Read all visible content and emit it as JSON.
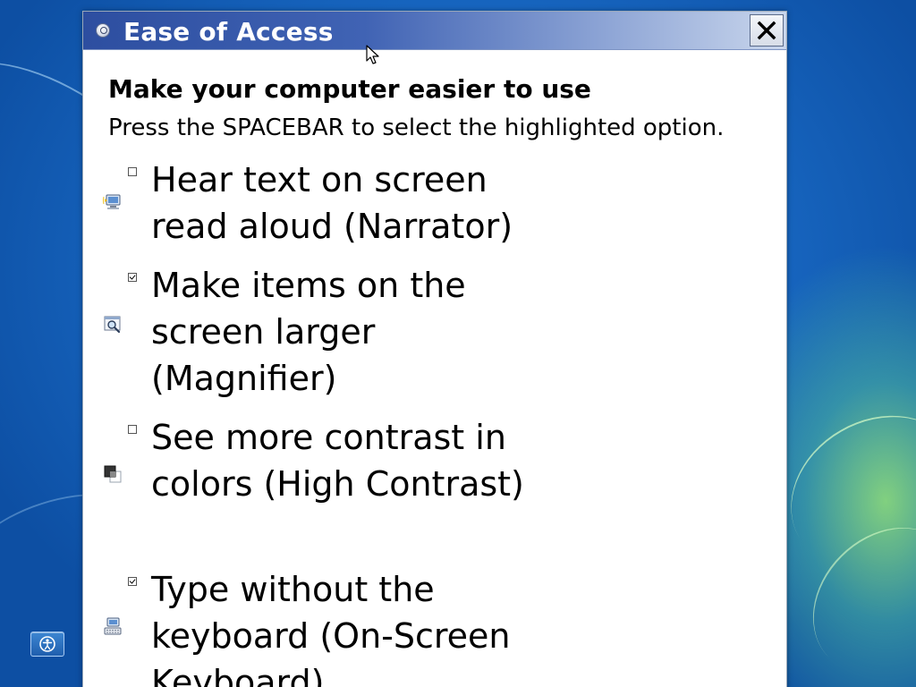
{
  "dialog": {
    "title": "Ease of Access",
    "close_icon": "close-icon",
    "heading": "Make your computer easier to use",
    "instruction": "Press the SPACEBAR to select the highlighted option.",
    "options": [
      {
        "label": "Hear text on screen read aloud (Narrator)",
        "checked": false,
        "icon": "narrator-icon"
      },
      {
        "label": "Make items on the screen larger (Magnifier)",
        "checked": true,
        "icon": "magnifier-icon"
      },
      {
        "label": "See more contrast in colors (High Contrast)",
        "checked": false,
        "icon": "high-contrast-icon"
      },
      {
        "label": "Type without the keyboard (On-Screen Keyboard)",
        "checked": true,
        "icon": "on-screen-keyboard-icon"
      }
    ]
  },
  "desktop": {
    "ease_of_access_button_icon": "ease-of-access-icon"
  },
  "colors": {
    "titlebar_dark": "#2d4ea0",
    "titlebar_light": "#c9d6ec",
    "dialog_background": "#ffffff",
    "desktop_blue": "#1a6cc8"
  }
}
